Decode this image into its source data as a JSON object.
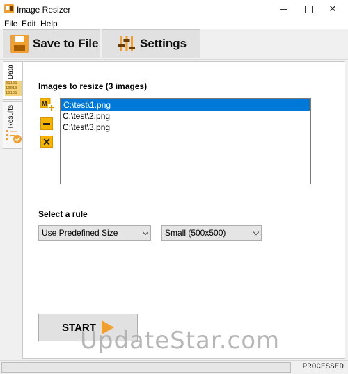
{
  "window": {
    "title": "Image Resizer"
  },
  "menu": {
    "items": [
      "File",
      "Edit",
      "Help"
    ]
  },
  "toolbar": {
    "save_label": "Save to File",
    "settings_label": "Settings"
  },
  "sidetabs": {
    "data_label": "Data",
    "results_label": "Results",
    "binary_text": "01101\n10010\n10101"
  },
  "images": {
    "label": "Images to resize (3 images)",
    "items": [
      "C:\\test\\1.png",
      "C:\\test\\2.png",
      "C:\\test\\3.png"
    ],
    "selected_index": 0
  },
  "rule": {
    "label": "Select a rule",
    "mode_value": "Use Predefined Size",
    "size_value": "Small (500x500)"
  },
  "start_label": "START",
  "watermark": "UpdateStar.com",
  "status": {
    "text": "PROCESSED",
    "progress": 0
  },
  "colors": {
    "accent": "#f0a030",
    "selection": "#0078d7"
  }
}
